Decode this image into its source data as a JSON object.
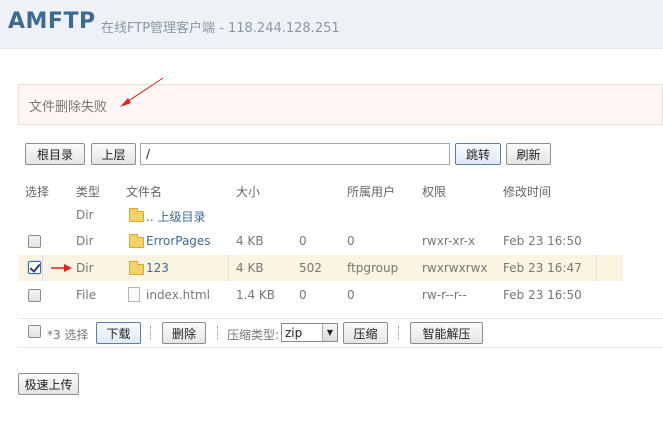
{
  "header": {
    "logo": "AMFTP",
    "subtitle": "在线FTP管理客户端 - 118.244.128.251"
  },
  "message": "文件删除失败",
  "toolbar": {
    "root_label": "根目录",
    "up_label": "上层",
    "path_value": "/",
    "jump_label": "跳转",
    "refresh_label": "刷新"
  },
  "table": {
    "columns": [
      "选择",
      "类型",
      "文件名",
      "大小",
      "",
      "所属用户",
      "权限",
      "修改时间"
    ],
    "parent_row": {
      "type": "Dir",
      "name": ".. 上级目录"
    },
    "rows": [
      {
        "checked": false,
        "type": "Dir",
        "icon": "folder-icon",
        "name": "ErrorPages",
        "size": "4 KB",
        "num": "0",
        "owner": "0",
        "perm": "rwxr-xr-x",
        "mtime": "Feb 23 16:50"
      },
      {
        "checked": true,
        "type": "Dir",
        "icon": "folder-icon",
        "name": "123",
        "size": "4 KB",
        "num": "502",
        "owner": "ftpgroup",
        "perm": "rwxrwxrwx",
        "mtime": "Feb 23 16:47"
      },
      {
        "checked": false,
        "type": "File",
        "icon": "file-icon",
        "name": "index.html",
        "size": "1.4 KB",
        "num": "0",
        "owner": "0",
        "perm": "rw-r--r--",
        "mtime": "Feb 23 16:50"
      }
    ]
  },
  "bottom": {
    "select_label": "*3 选择",
    "download_label": "下载",
    "delete_label": "删除",
    "compress_type_label": "压缩类型:",
    "compress_type_value": "zip",
    "compress_label": "压缩",
    "extract_label": "智能解压"
  },
  "upload_label": "极速上传",
  "colors": {
    "accent": "#3b6a93",
    "annotation_arrow": "#e02020",
    "selected_row": "#fbf4e3"
  }
}
